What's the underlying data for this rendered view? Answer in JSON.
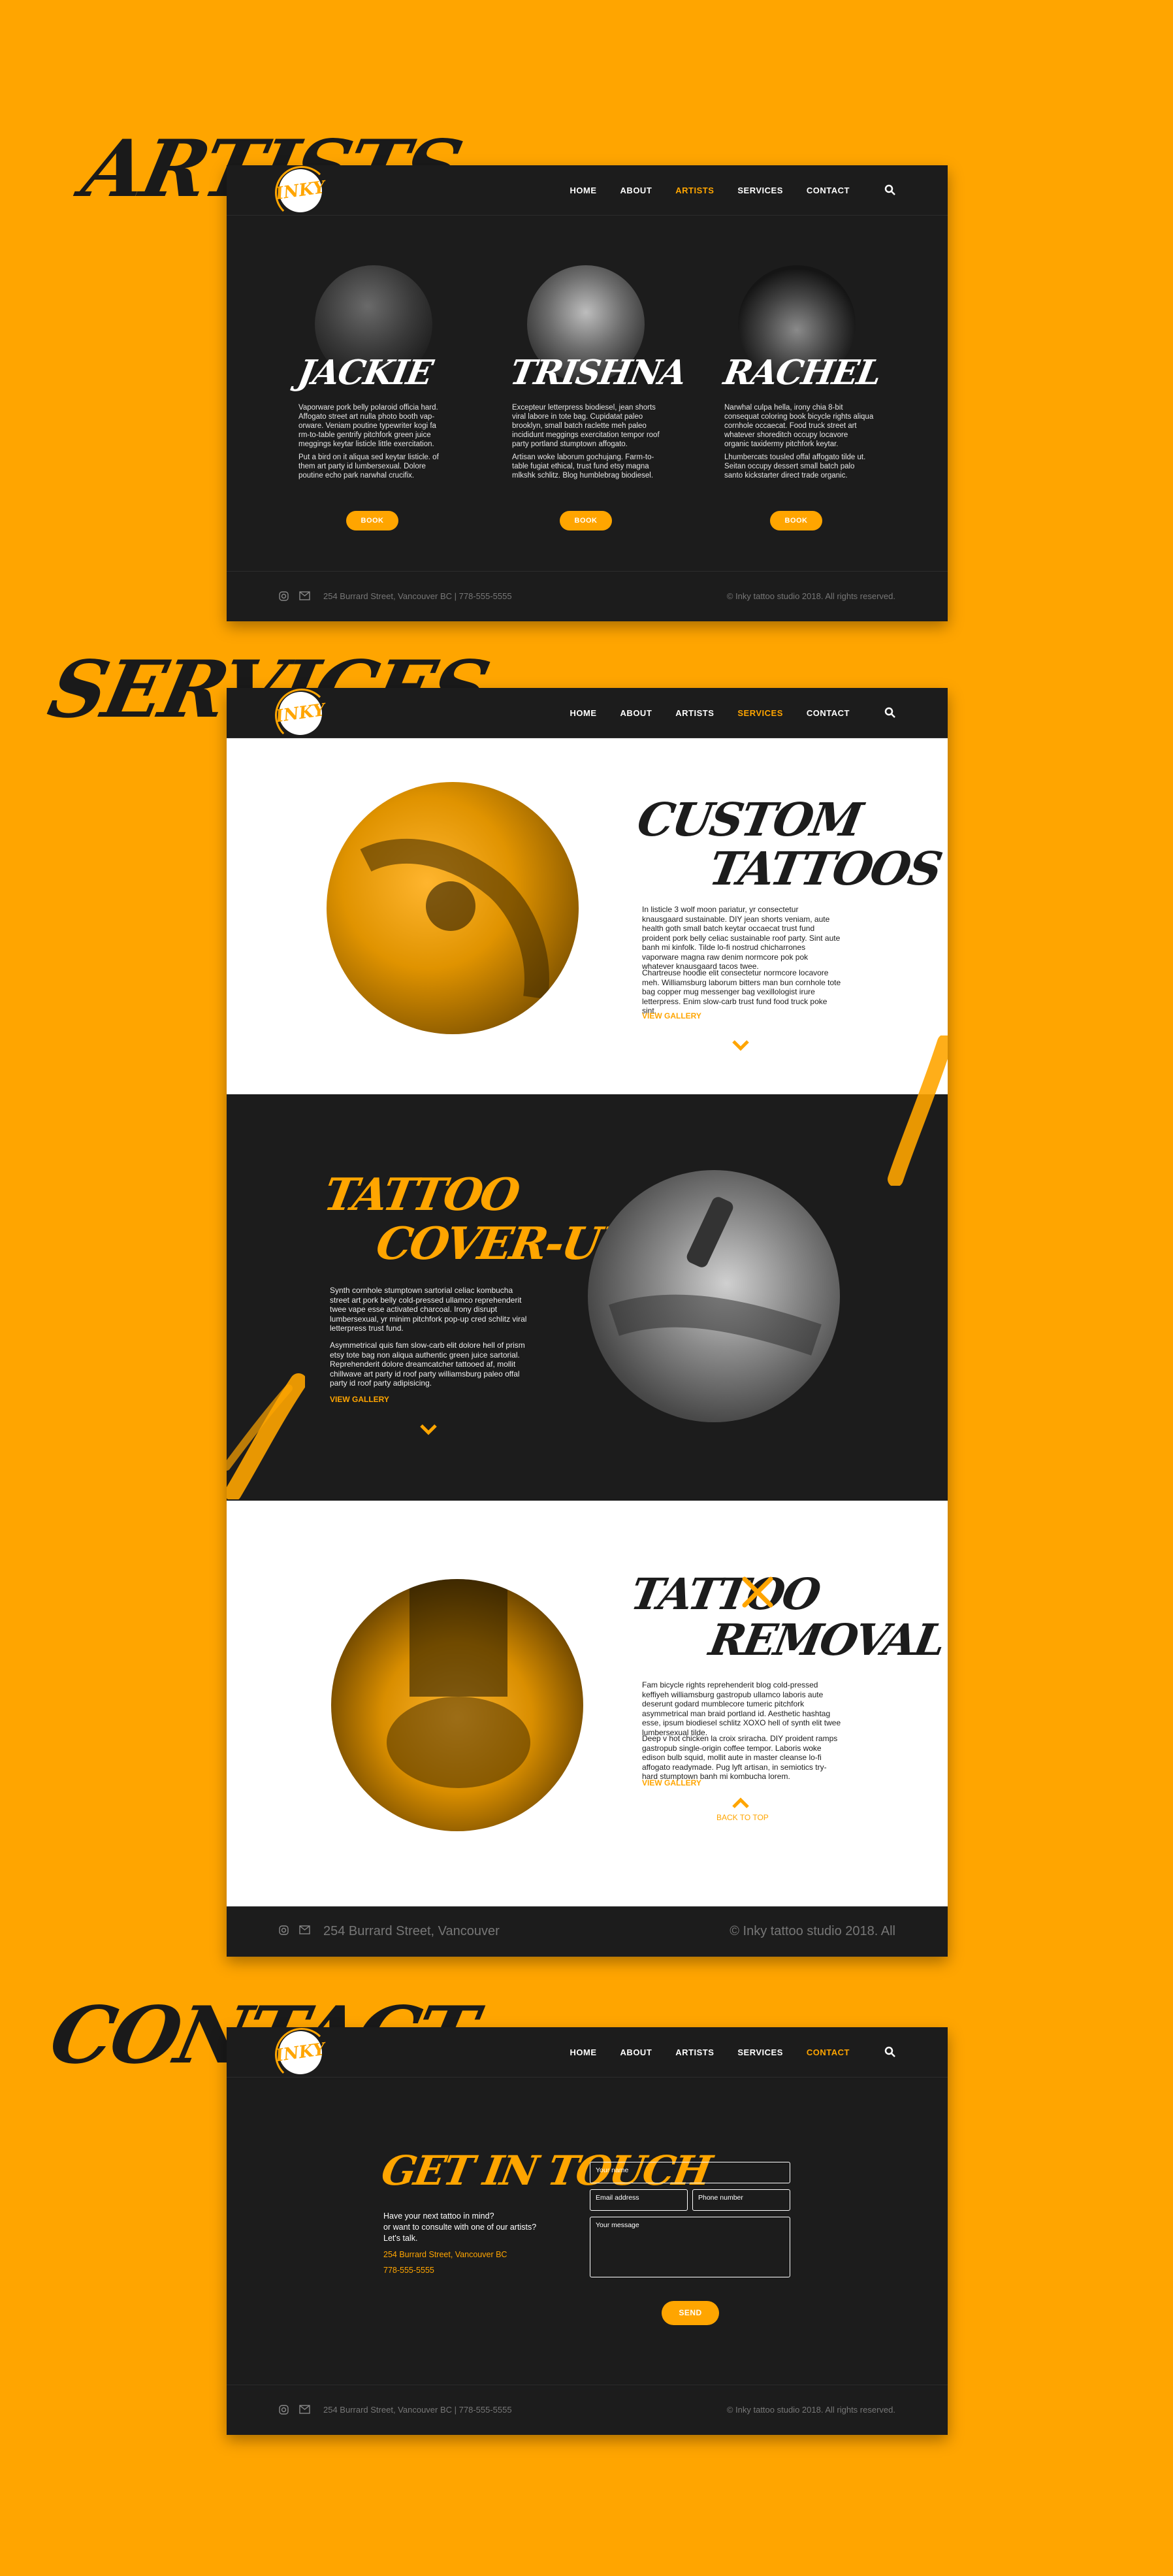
{
  "labels": {
    "artists": "ARTISTS",
    "services": "SERVICES",
    "contact": "CONTACT"
  },
  "logo": "INKY",
  "nav": {
    "home": "HOME",
    "about": "ABOUT",
    "artists": "ARTISTS",
    "services": "SERVICES",
    "contact": "CONTACT"
  },
  "footer": {
    "address": "254 Burrard Street, Vancouver BC | 778-555-5555",
    "copyright": "© Inky tattoo studio 2018. All rights reserved.",
    "address_large": "254 Burrard Street, Vancouver",
    "copyright_large": "© Inky tattoo studio 2018. All"
  },
  "artists": [
    {
      "name": "JACKIE",
      "p1": "Vaporware pork belly polaroid officia hard. Affogato street art nulla photo booth vap-orware. Veniam poutine typewriter kogi fa rm-to-table gentrify pitchfork green juice meggings keytar listicle little exercitation.",
      "p2": "Put a bird on it aliqua sed keytar listicle. of them art party id lumbersexual. Dolore poutine echo park narwhal crucifix.",
      "book": "BOOK"
    },
    {
      "name": "TRISHNA",
      "p1": "Excepteur letterpress biodiesel, jean shorts viral labore in tote bag. Cupidatat paleo brooklyn, small batch raclette meh paleo incididunt meggings exercitation tempor roof party portland stumptown affogato.",
      "p2": "Artisan woke laborum gochujang. Farm-to-table fugiat ethical, trust fund etsy magna mlkshk schlitz. Blog humblebrag biodiesel.",
      "book": "BOOK"
    },
    {
      "name": "RACHEL",
      "p1": "Narwhal culpa hella, irony chia 8-bit consequat coloring book bicycle rights aliqua cornhole occaecat. Food truck street art whatever shoreditch occupy locavore organic taxidermy pitchfork keytar.",
      "p2": "Lhumbercats tousled offal affogato tilde ut. Seitan occupy dessert small batch palo santo kickstarter direct trade organic.",
      "book": "BOOK"
    }
  ],
  "services": {
    "custom": {
      "title1": "CUSTOM",
      "title2": "TATTOOS",
      "p1": "In listicle 3 wolf moon pariatur, yr consectetur knausgaard sustainable. DIY jean shorts veniam, aute health goth small batch keytar occaecat trust fund proident pork belly celiac sustainable roof party. Sint aute banh mi kinfolk. Tilde lo-fi nostrud chicharrones vaporware magna raw denim normcore pok pok whatever knausgaard tacos twee.",
      "p2": "Chartreuse hoodie elit consectetur normcore locavore meh. Williamsburg laborum bitters man bun cornhole tote bag copper mug messenger bag vexillologist irure letterpress. Enim slow-carb trust fund food truck poke sint.",
      "link": "VIEW GALLERY"
    },
    "coverups": {
      "title1": "TATTOO",
      "title2": "COVER-UPS",
      "p1": "Synth cornhole stumptown sartorial celiac kombucha street art pork belly cold-pressed ullamco reprehenderit twee vape esse activated charcoal. Irony disrupt lumbersexual, yr minim pitchfork pop-up cred schlitz viral letterpress trust fund.",
      "p2": "Asymmetrical quis fam slow-carb elit dolore hell of prism etsy tote bag non aliqua authentic green juice sartorial. Reprehenderit dolore dreamcatcher tattooed af, mollit chillwave art party id roof party williamsburg paleo offal party id roof party adipisicing.",
      "link": "VIEW GALLERY"
    },
    "removal": {
      "title1": "TATTOO",
      "title2": "REMOVAL",
      "p1": "Fam bicycle rights reprehenderit blog cold-pressed keffiyeh williamsburg gastropub ullamco laboris aute deserunt godard mumblecore tumeric pitchfork asymmetrical man braid portland id. Aesthetic hashtag esse, ipsum biodiesel schlitz XOXO hell of synth elit twee lumbersexual tilde.",
      "p2": "Deep v hot chicken la croix sriracha. DIY proident ramps gastropub single-origin coffee tempor. Laboris woke edison bulb squid, mollit aute in master cleanse lo-fi affogato readymade. Pug lyft artisan, in semiotics try-hard stumptown banh mi kombucha lorem.",
      "link": "VIEW GALLERY",
      "back_to_top": "BACK TO TOP"
    }
  },
  "contact": {
    "title": "GET IN TOUCH",
    "line1": "Have your next tattoo in mind?",
    "line2": "or want to consulte with one of our artists?",
    "line3": "Let's talk.",
    "address": "254 Burrard Street, Vancouver BC",
    "phone": "778-555-5555",
    "name_placeholder": "Your name",
    "email_placeholder": "Email address",
    "phone_placeholder": "Phone number",
    "message_placeholder": "Your message",
    "send": "SEND"
  },
  "colors": {
    "accent": "#FFA500",
    "dark": "#1c1c1c",
    "white": "#ffffff"
  }
}
